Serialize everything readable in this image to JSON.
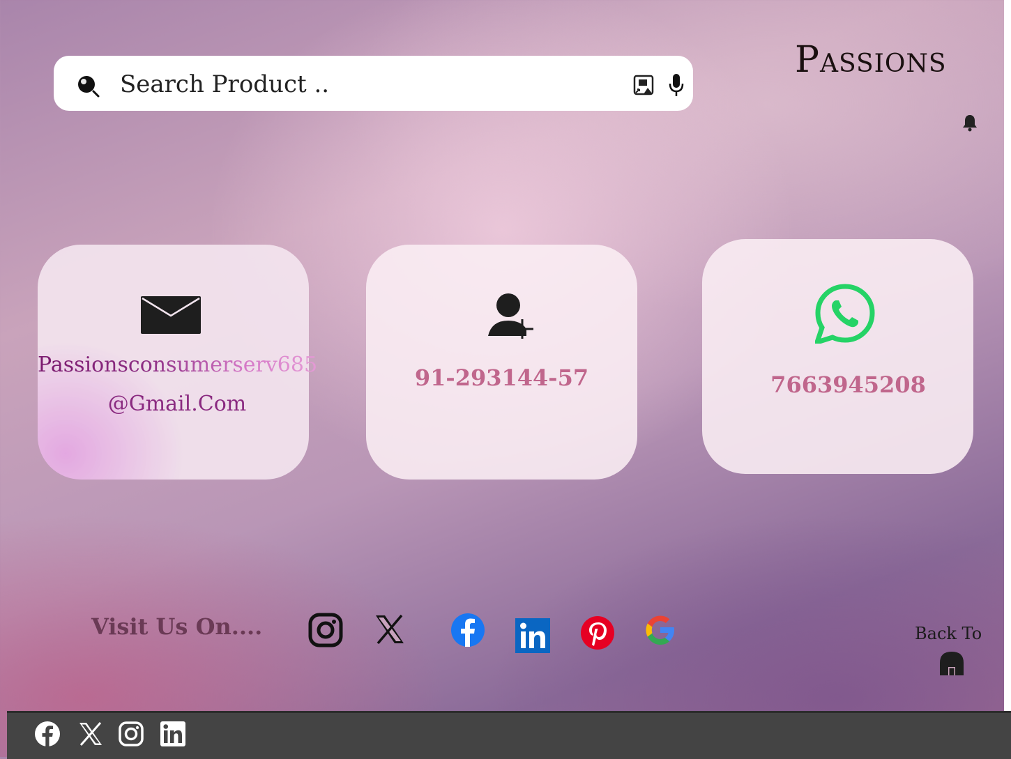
{
  "header": {
    "search": {
      "placeholder": "Search Product .."
    },
    "brand": "Passions"
  },
  "contact_cards": {
    "email": {
      "line1": "Passionsconsumerserv685",
      "line2": "@Gmail.Com"
    },
    "phone": {
      "number": "91-293144-57"
    },
    "whatsapp": {
      "number": "7663945208"
    }
  },
  "social": {
    "visit_label": "Visit Us On....",
    "icons": [
      "instagram-icon",
      "x-icon",
      "facebook-icon",
      "linkedin-icon",
      "pinterest-icon",
      "google-icon"
    ]
  },
  "back": {
    "label": "Back To",
    "icon": "home-icon"
  },
  "footer": {
    "icons": [
      "facebook-icon",
      "x-icon",
      "instagram-icon",
      "linkedin-icon"
    ]
  },
  "colors": {
    "accent_number": "#c0668c",
    "whatsapp_green": "#25d366",
    "facebook_blue": "#1877f2",
    "linkedin_blue": "#0a66c2",
    "pinterest_red": "#e60023",
    "footer_bg": "#444444"
  }
}
